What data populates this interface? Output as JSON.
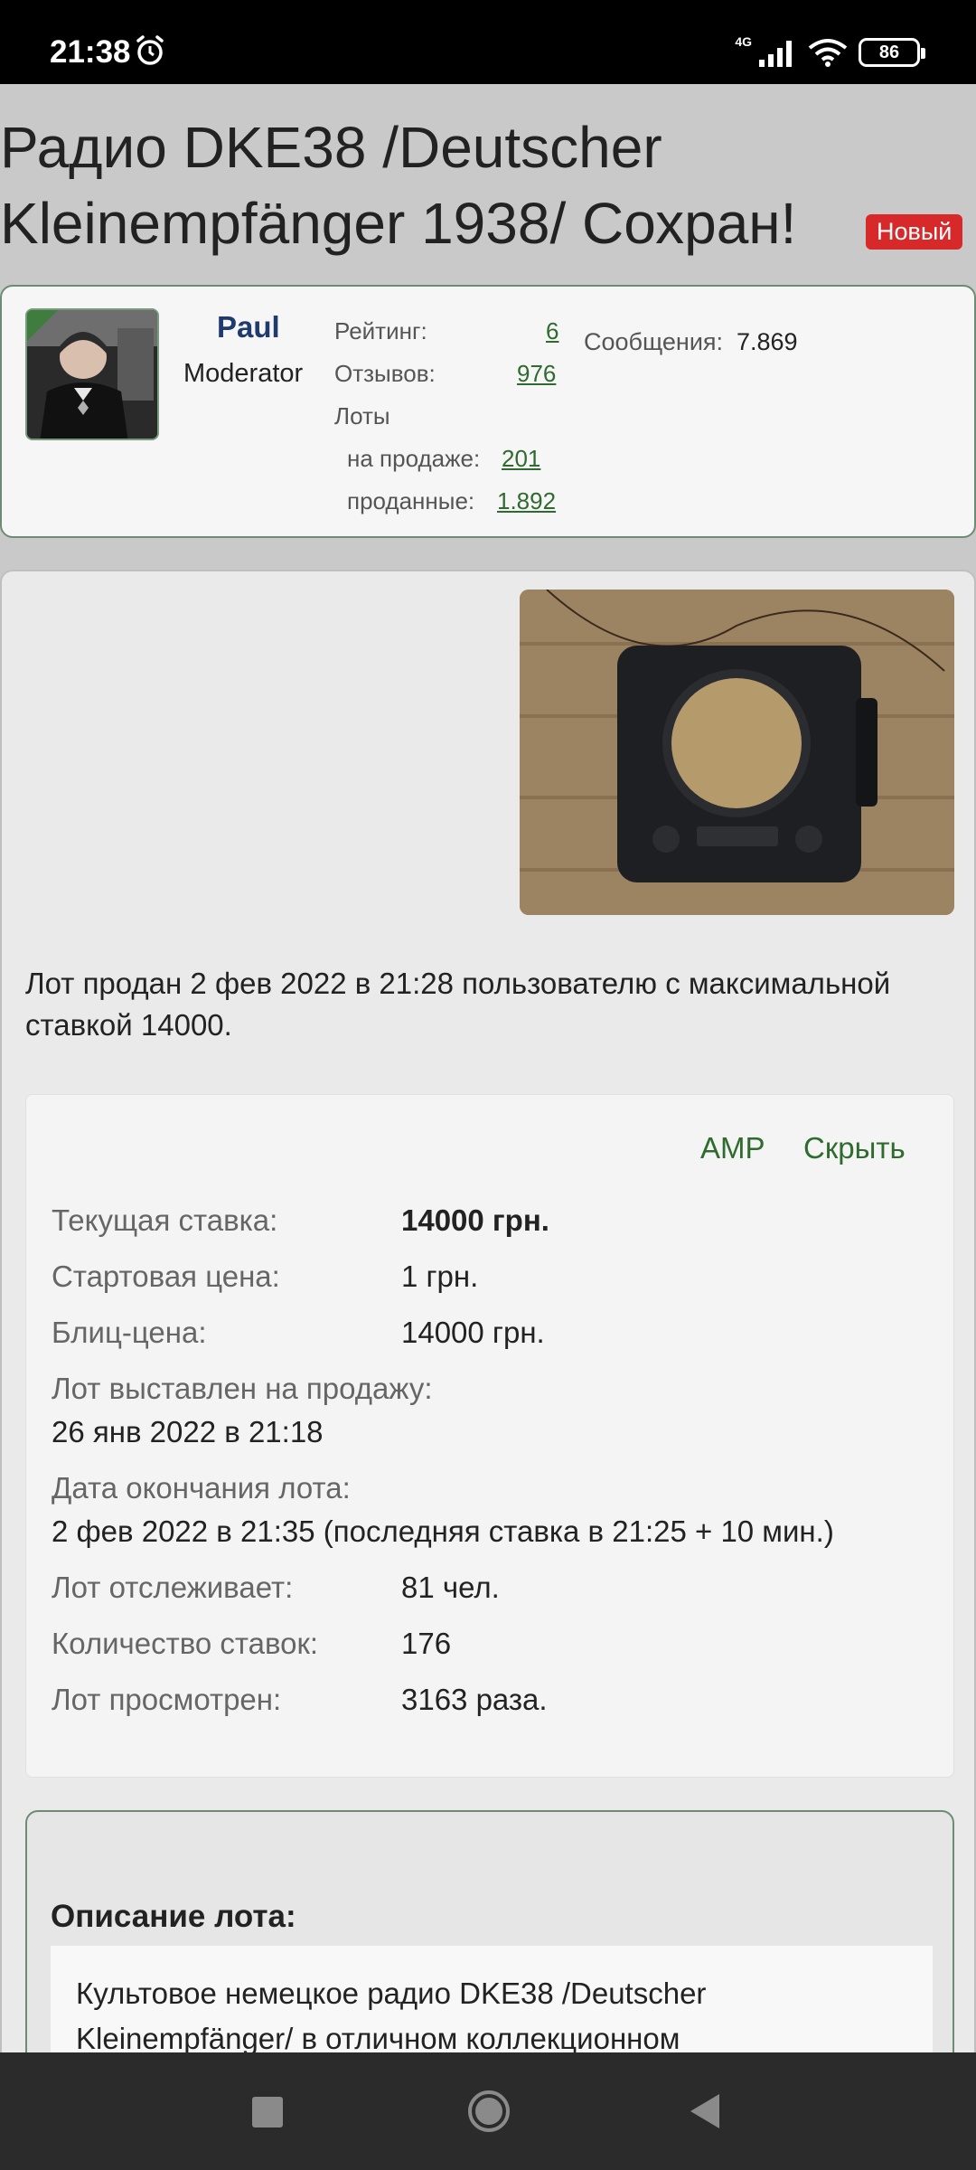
{
  "status_bar": {
    "time": "21:38",
    "network": "4G",
    "battery": "86"
  },
  "lot": {
    "title": "Радио DKE38 /Deutscher Kleinempfänger 1938/ Сохран!",
    "badge": "Новый",
    "sold_message": "Лот продан 2 фев 2022 в 21:28 пользователю с максимальной ставкой 14000."
  },
  "seller": {
    "name": "Paul",
    "role": "Moderator",
    "rating_label": "Рейтинг:",
    "rating_value": "6",
    "reviews_label": "Отзывов:",
    "reviews_value": "976",
    "lots_label": "Лоты",
    "on_sale_label": "на продаже:",
    "on_sale_value": "201",
    "sold_label": "проданные:",
    "sold_value": "1.892",
    "messages_label": "Сообщения:",
    "messages_value": "7.869"
  },
  "info": {
    "amp_link": "AMP",
    "hide_link": "Скрыть",
    "current_bid_label": "Текущая ставка:",
    "current_bid_value": "14000 грн.",
    "start_price_label": "Стартовая цена:",
    "start_price_value": "1 грн.",
    "blitz_price_label": "Блиц-цена:",
    "blitz_price_value": "14000 грн.",
    "listed_label": "Лот выставлен на продажу:",
    "listed_value": "26 янв 2022 в 21:18",
    "end_label": "Дата окончания лота:",
    "end_value": "2 фев 2022 в 21:35 (последняя ставка в 21:25 + 10 мин.)",
    "watchers_label": "Лот отслеживает:",
    "watchers_value": "81 чел.",
    "bids_label": "Количество ставок:",
    "bids_value": "176",
    "views_label": "Лот просмотрен:",
    "views_value": "3163 раза."
  },
  "description": {
    "title": "Описание лота:",
    "text": "Культовое немецкое радио DKE38 /Deutscher Kleinempfänger/ в отличном коллекционном"
  },
  "colors": {
    "accent_green": "#2f6b2f",
    "badge_red": "#d7292a",
    "username_blue": "#1e3a6e"
  }
}
